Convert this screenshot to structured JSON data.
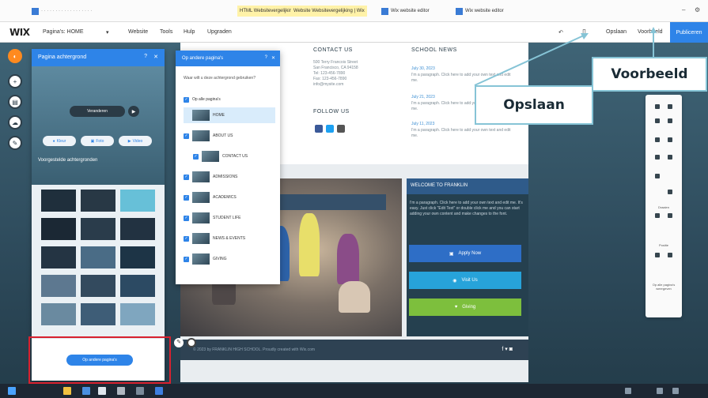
{
  "browser": {
    "tabs": [
      {
        "label": "HTML Websitevergelijking ahw"
      },
      {
        "label": "Website Websitevergelijking | Wix"
      },
      {
        "label": "Wix website editor"
      },
      {
        "label": "Wix website editor"
      }
    ]
  },
  "wixbar": {
    "logo": "WIX",
    "page_selector": "Pagina's: HOME",
    "menu": [
      "Website",
      "Tools",
      "Hulp",
      "Upgraden"
    ],
    "save_label": "Opslaan",
    "preview_label": "Voorbeeld",
    "publish_label": "Publiceren"
  },
  "left_tools": [
    "background-icon",
    "add-icon",
    "media-icon",
    "upload-icon",
    "blog-icon"
  ],
  "bg_panel": {
    "title": "Pagina achtergrond",
    "change_label": "Veranderen",
    "options": [
      "Kleur",
      "Foto",
      "Video"
    ],
    "presets_title": "Voorgestelde achtergronden",
    "apply_label": "Op andere pagina's"
  },
  "pages_panel": {
    "title": "Op andere pagina's",
    "question": "Waar wilt u deze achtergrond gebruiken?",
    "all_label": "Op alle pagina's",
    "pages": [
      "HOME",
      "ABOUT US",
      "CONTACT US",
      "ADMISSIONS",
      "ACADEMICS",
      "STUDENT LIFE",
      "NEWS & EVENTS",
      "GIVING"
    ]
  },
  "site": {
    "contact_title": "CONTACT US",
    "address": "500 Terry Francois Street\nSan Francisco, CA 94158\nTel: 123-456-7890\nFax: 123-456-7890\ninfo@mysite.com",
    "follow_title": "FOLLOW US",
    "news_title": "SCHOOL NEWS",
    "news": [
      {
        "date": "July 30, 2023",
        "text": "I'm a paragraph. Click here to add your own text and edit me."
      },
      {
        "date": "July 21, 2023",
        "text": "I'm a paragraph. Click here to add your own text and edit me."
      },
      {
        "date": "July 11, 2023",
        "text": "I'm a paragraph. Click here to add your own text and edit me."
      }
    ],
    "welcome_title": "WELCOME TO FRANKLIN",
    "welcome_text": "I'm a paragraph. Click here to add your own text and edit me. It's easy. Just click \"Edit Text\" or double click me and you can start adding your own content and make changes to the font.",
    "buttons": [
      "Apply Now",
      "Visit Us",
      "Giving"
    ],
    "footer_text": "© 2023 by FRANKLIN HIGH SCHOOL. Proudly created with Wix.com"
  },
  "right_toolbar": {
    "labels": [
      "Draaien",
      "Positie",
      "Op alle pagina's weergeven"
    ]
  },
  "callouts": {
    "voorbeeld": "Voorbeeld",
    "opslaan": "Opslaan"
  },
  "colors": {
    "wix_blue": "#2e84e8",
    "callout_border": "#86c4d6",
    "highlight_red": "#d8212f",
    "tool_active": "#ff8a1f"
  }
}
